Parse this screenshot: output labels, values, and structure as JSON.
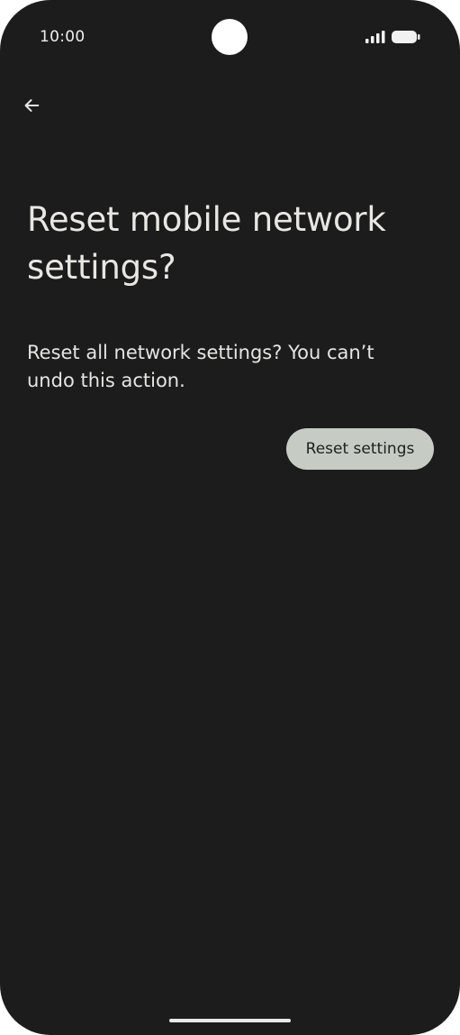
{
  "status_bar": {
    "time": "10:00",
    "icons": [
      "signal-icon",
      "battery-icon"
    ]
  },
  "toolbar": {
    "back_icon": "arrow-back-icon"
  },
  "main": {
    "title": "Reset mobile network settings?",
    "body": "Reset all network settings? You can’t undo this action.",
    "reset_button_label": "Reset settings"
  },
  "colors": {
    "background": "#1b1c1b",
    "text_primary": "#e9e7e3",
    "button_background": "#c6cbc4",
    "button_text": "#1d201d",
    "camera_cutout": "#ffffff"
  }
}
